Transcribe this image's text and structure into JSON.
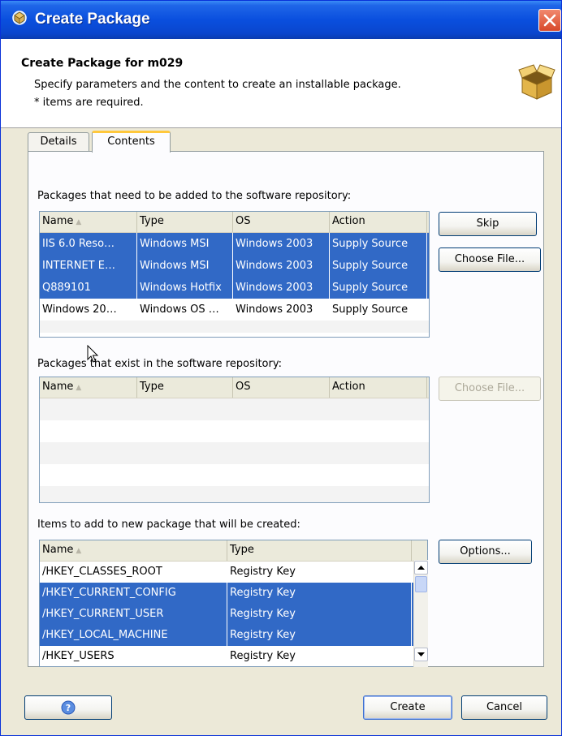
{
  "window": {
    "title": "Create Package",
    "colors": {
      "titlebar": "#0A4FDE",
      "selection": "#3169C6",
      "face": "#ECE9D8"
    }
  },
  "header": {
    "title": "Create Package for m029",
    "description": "Specify parameters and the content to create an installable package.",
    "required_note": "* items are required.",
    "icon": "package-box-icon"
  },
  "tabs": [
    {
      "label": "Details",
      "active": false
    },
    {
      "label": "Contents",
      "active": true
    }
  ],
  "repo_add": {
    "label": "Packages that need to be added to the software repository:",
    "columns": [
      "Name",
      "Type",
      "OS",
      "Action"
    ],
    "rows": [
      {
        "name": "IIS 6.0 Reso…",
        "type": "Windows MSI",
        "os": "Windows 2003",
        "action": "Supply Source",
        "selected": true
      },
      {
        "name": "INTERNET E…",
        "type": "Windows MSI",
        "os": "Windows 2003",
        "action": "Supply Source",
        "selected": true
      },
      {
        "name": "Q889101",
        "type": "Windows Hotfix",
        "os": "Windows 2003",
        "action": "Supply Source",
        "selected": true
      },
      {
        "name": "Windows 20…",
        "type": "Windows OS …",
        "os": "Windows 2003",
        "action": "Supply Source",
        "selected": false
      }
    ],
    "skip_button": "Skip",
    "choose_file_button": "Choose File..."
  },
  "repo_existing": {
    "label": "Packages that exist in the software repository:",
    "columns": [
      "Name",
      "Type",
      "OS",
      "Action"
    ],
    "choose_file_button": "Choose File..."
  },
  "new_items": {
    "label": "Items to add to new package that will be created:",
    "columns": [
      "Name",
      "Type"
    ],
    "rows": [
      {
        "name": "/HKEY_CLASSES_ROOT",
        "type": "Registry Key",
        "selected": false
      },
      {
        "name": "/HKEY_CURRENT_CONFIG",
        "type": "Registry Key",
        "selected": true
      },
      {
        "name": "/HKEY_CURRENT_USER",
        "type": "Registry Key",
        "selected": true
      },
      {
        "name": "/HKEY_LOCAL_MACHINE",
        "type": "Registry Key",
        "selected": true
      },
      {
        "name": "/HKEY_USERS",
        "type": "Registry Key",
        "selected": false
      }
    ],
    "options_button": "Options..."
  },
  "footer": {
    "help_icon": "help-icon",
    "create_button": "Create",
    "cancel_button": "Cancel"
  }
}
